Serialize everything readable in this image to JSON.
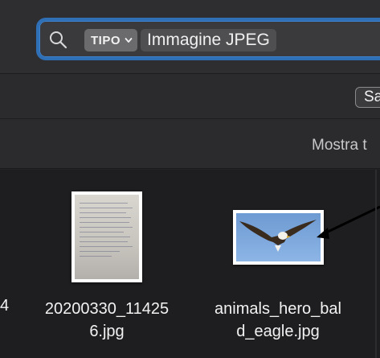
{
  "search": {
    "token_label": "TIPO",
    "token_value": "Immagine JPEG",
    "icon": "search-icon"
  },
  "savebar": {
    "save_label": "Sa"
  },
  "showbar": {
    "show_all_label": "Mostra t"
  },
  "files": [
    {
      "name_line1": "20200330_11425",
      "name_line2": "6.jpg",
      "icon": "handwritten-page-thumbnail"
    },
    {
      "name_line1": "animals_hero_bal",
      "name_line2": "d_eagle.jpg",
      "icon": "eagle-photo-thumbnail"
    }
  ],
  "partial_left_label": "4",
  "colors": {
    "focus_ring": "#2f6fb6",
    "background": "#1e1e20"
  }
}
